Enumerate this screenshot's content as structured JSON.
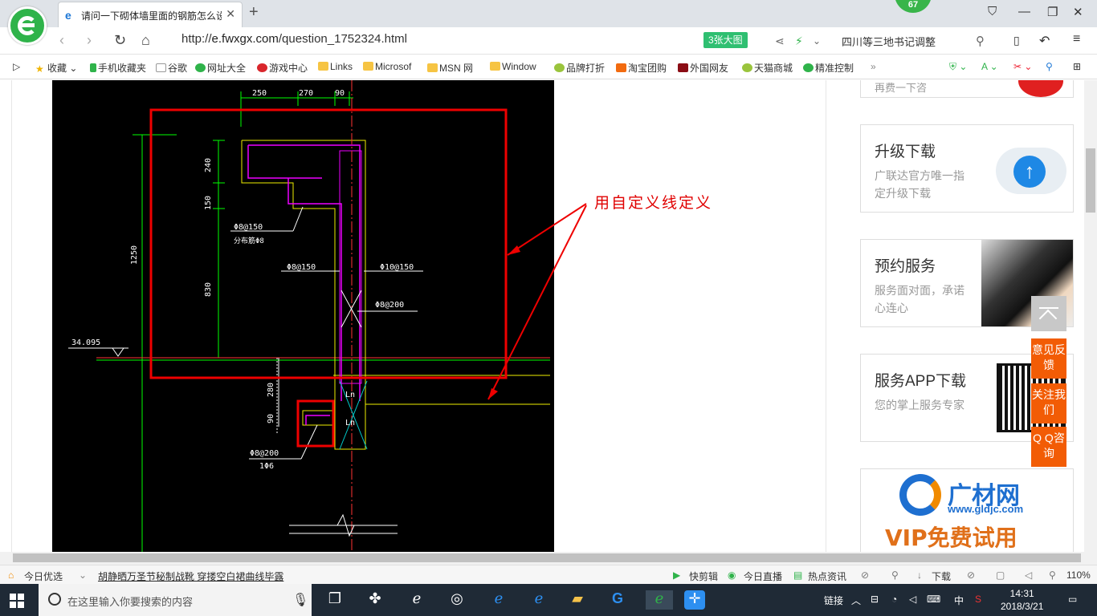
{
  "browser": {
    "tab_title": "请问一下砌体墙里面的钢筋怎么设置",
    "notif_count": "67",
    "url_prefix": "http://",
    "url_host": "e.fwxgx.com",
    "url_path": "/question_1752324.html",
    "big_image_label": "3张大图",
    "news_text": "四川等三地书记调整"
  },
  "bookmarks": [
    "收藏",
    "手机收藏夹",
    "谷歌",
    "网址大全",
    "游戏中心",
    "Links",
    "Microsof",
    "MSN 网",
    "Window",
    "品牌打折",
    "淘宝团购",
    "外国网友",
    "天猫商城",
    "精准控制"
  ],
  "cad": {
    "dims_top": [
      "250",
      "270",
      "90"
    ],
    "dims_left": [
      "240",
      "150",
      "830",
      "1250",
      "280",
      "90"
    ],
    "elevation": "34.095",
    "labels": {
      "a": "Φ8@150",
      "b": "分布筋Φ8",
      "c": "Φ8@150",
      "d": "Φ10@150",
      "e": "Φ8@200",
      "f": "Φ8@200",
      "g": "1Φ6",
      "ln": "Ln"
    },
    "annotation": "用自定义线定义"
  },
  "sidebar": {
    "card0_text": "再费一下咨",
    "card1": {
      "title": "升级下载",
      "desc": "广联达官方唯一指定升级下载"
    },
    "card2": {
      "title": "预约服务",
      "desc": "服务面对面，承诺心连心"
    },
    "card3": {
      "title": "服务APP下载",
      "desc": "您的掌上服务专家"
    },
    "card4": {
      "logo": "广材网",
      "site": "www.gldjc.com",
      "promo": "VIP免费试用"
    }
  },
  "floating": {
    "feedback": "意见反馈",
    "follow": "关注我们",
    "qq": "Q Q咨询"
  },
  "statusbar": {
    "today": "今日优选",
    "headline": "胡静晒万圣节秘制战靴 穿搂空白裙曲线毕露",
    "items": [
      "快剪辑",
      "今日直播",
      "热点资讯",
      "下载"
    ],
    "zoom": "110%"
  },
  "taskbar": {
    "search_placeholder": "在这里输入你要搜索的内容",
    "tray_link": "链接",
    "ime": "中",
    "time": "14:31",
    "date": "2018/3/21"
  },
  "colors": {
    "accent_green": "#2fb34a",
    "cad_bg": "#000000",
    "annotation": "#e00000",
    "side_orange": "#f25c05"
  }
}
